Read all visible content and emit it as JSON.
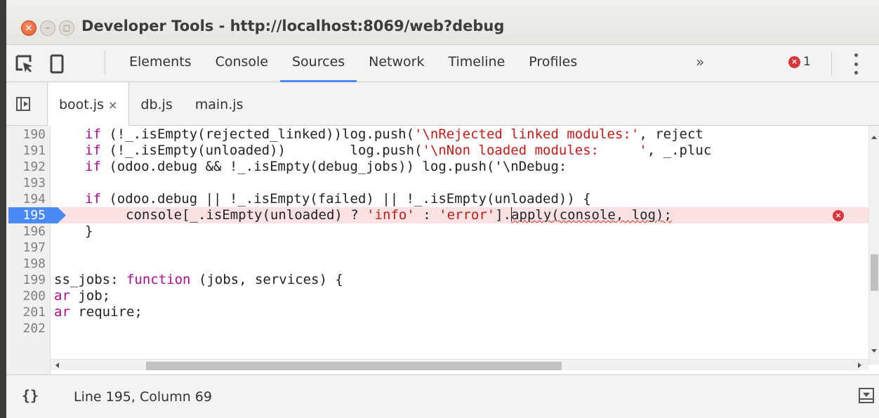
{
  "window": {
    "title": "Developer Tools - http://localhost:8069/web?debug",
    "close_glyph": "×",
    "min_glyph": "–",
    "max_glyph": "□"
  },
  "toolbar": {
    "tabs": [
      {
        "label": "Elements",
        "active": false
      },
      {
        "label": "Console",
        "active": false
      },
      {
        "label": "Sources",
        "active": true
      },
      {
        "label": "Network",
        "active": false
      },
      {
        "label": "Timeline",
        "active": false
      },
      {
        "label": "Profiles",
        "active": false
      }
    ],
    "more_glyph": "»",
    "error_count": "1",
    "error_glyph": "×",
    "accent_color": "#4a8af4",
    "error_color": "#d9373b"
  },
  "file_tabs": [
    {
      "label": "boot.js",
      "active": true,
      "close_glyph": "×"
    },
    {
      "label": "db.js",
      "active": false
    },
    {
      "label": "main.js",
      "active": false
    }
  ],
  "editor": {
    "lines": [
      {
        "num": "190",
        "code": "if (!_.isEmpty(rejected_linked))log.push('\\nRejected linked modules:', reject"
      },
      {
        "num": "191",
        "code": "if (!_.isEmpty(unloaded))        log.push('\\nNon loaded modules:     ', _.pluc"
      },
      {
        "num": "192",
        "code": "if (odoo.debug && !_.isEmpty(debug_jobs)) log.push('\\nDebug:"
      },
      {
        "num": "193",
        "code": ""
      },
      {
        "num": "194",
        "code": "if (odoo.debug || !_.isEmpty(failed) || !_.isEmpty(unloaded)) {"
      },
      {
        "num": "195",
        "code": "console[_.isEmpty(unloaded) ? 'info' : 'error'].apply(console, log);"
      },
      {
        "num": "196",
        "code": "}"
      },
      {
        "num": "197",
        "code": ""
      },
      {
        "num": "198",
        "code": ""
      },
      {
        "num": "199",
        "code": "ss_jobs: function (jobs, services) {"
      },
      {
        "num": "200",
        "code": "ar job;"
      },
      {
        "num": "201",
        "code": "ar require;"
      },
      {
        "num": "202",
        "code": ""
      }
    ],
    "line_error_glyph": "×",
    "breakpoint_color": "#4a8af4",
    "highlight_color": "#fbe2e2"
  },
  "status": {
    "pretty_print_glyph": "{}",
    "cursor_position": "Line 195, Column 69"
  }
}
